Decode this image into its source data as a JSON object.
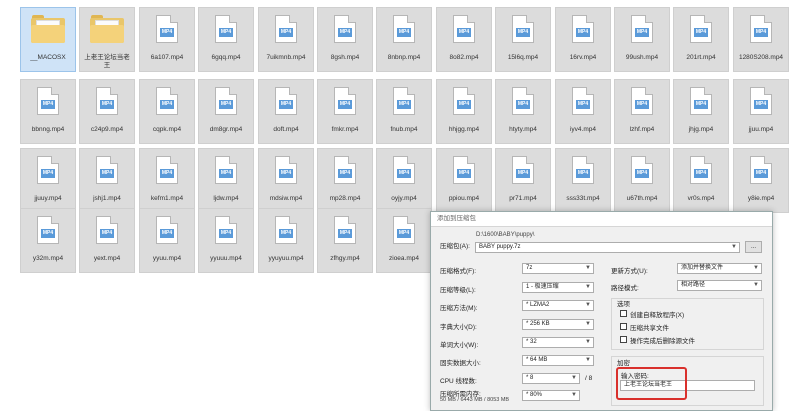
{
  "explorer": {
    "rows": [
      [
        "__MACOSX",
        "上老王论坛当老王",
        "6a107.mp4",
        "6gqq.mp4",
        "7uikmnb.mp4",
        "8gsh.mp4",
        "8nbnp.mp4",
        "8o82.mp4",
        "15l6q.mp4",
        "16rv.mp4",
        "99ush.mp4",
        "201rt.mp4",
        "1280S208.mp4"
      ],
      [
        "bbnng.mp4",
        "c24p9.mp4",
        "cqpk.mp4",
        "dm8gr.mp4",
        "doft.mp4",
        "fmkr.mp4",
        "fnub.mp4",
        "hhjgg.mp4",
        "htyty.mp4",
        "iyv4.mp4",
        "lzhf.mp4",
        "jhjg.mp4",
        "jjuu.mp4"
      ],
      [
        "jjuuy.mp4",
        "jshj1.mp4",
        "kefm1.mp4",
        "ljdw.mp4",
        "mdsiw.mp4",
        "mp28.mp4",
        "oyjy.mp4",
        "ppiou.mp4",
        "pr71.mp4",
        "sss33t.mp4",
        "u67th.mp4",
        "vr0s.mp4",
        "y8ie.mp4"
      ],
      [
        "y32m.mp4",
        "yext.mp4",
        "yyuu.mp4",
        "yyuuu.mp4",
        "yyuyuu.mp4",
        "zfhgy.mp4",
        "zioea.mp4"
      ]
    ],
    "file_badge": "MP4"
  },
  "dialog": {
    "title": "添加到压缩包",
    "archive_label": "压缩包(A):",
    "archive_path": "D:\\1600\\BABY\\puppy\\",
    "archive_name": "BABY puppy.7z",
    "browse_label": "...",
    "format_label": "压缩格式(F):",
    "format_value": "7z",
    "level_label": "压缩等级(L):",
    "level_value": "1 - 极速压缩",
    "method_label": "压缩方法(M):",
    "method_value": "* LZMA2",
    "dict_label": "字典大小(D):",
    "dict_value": "* 256 KB",
    "word_label": "单词大小(W):",
    "word_value": "* 32",
    "solid_label": "固实数据大小:",
    "solid_value": "* 64 MB",
    "cpu_label": "CPU 线程数:",
    "cpu_value": "* 8",
    "cpu_total": "/ 8",
    "mem_label": "压缩所需内存:",
    "mem_detail": "50 MB / 6443 MB / 8053 MB",
    "mem_value": "* 80%",
    "update_label": "更新方式(U):",
    "update_value": "添加并替换文件",
    "pathmode_label": "路径模式:",
    "pathmode_value": "相对路径",
    "options_title": "选项",
    "opt1": "创建自释放程序(X)",
    "opt2": "压缩共享文件",
    "opt3": "操作完成后删除源文件",
    "encrypt_title": "加密",
    "password_label": "输入密码:",
    "password_value": "上老王论坛当老王"
  },
  "colors": {
    "highlight_red": "#d9302c",
    "mp4_badge": "#5a9ad9"
  }
}
